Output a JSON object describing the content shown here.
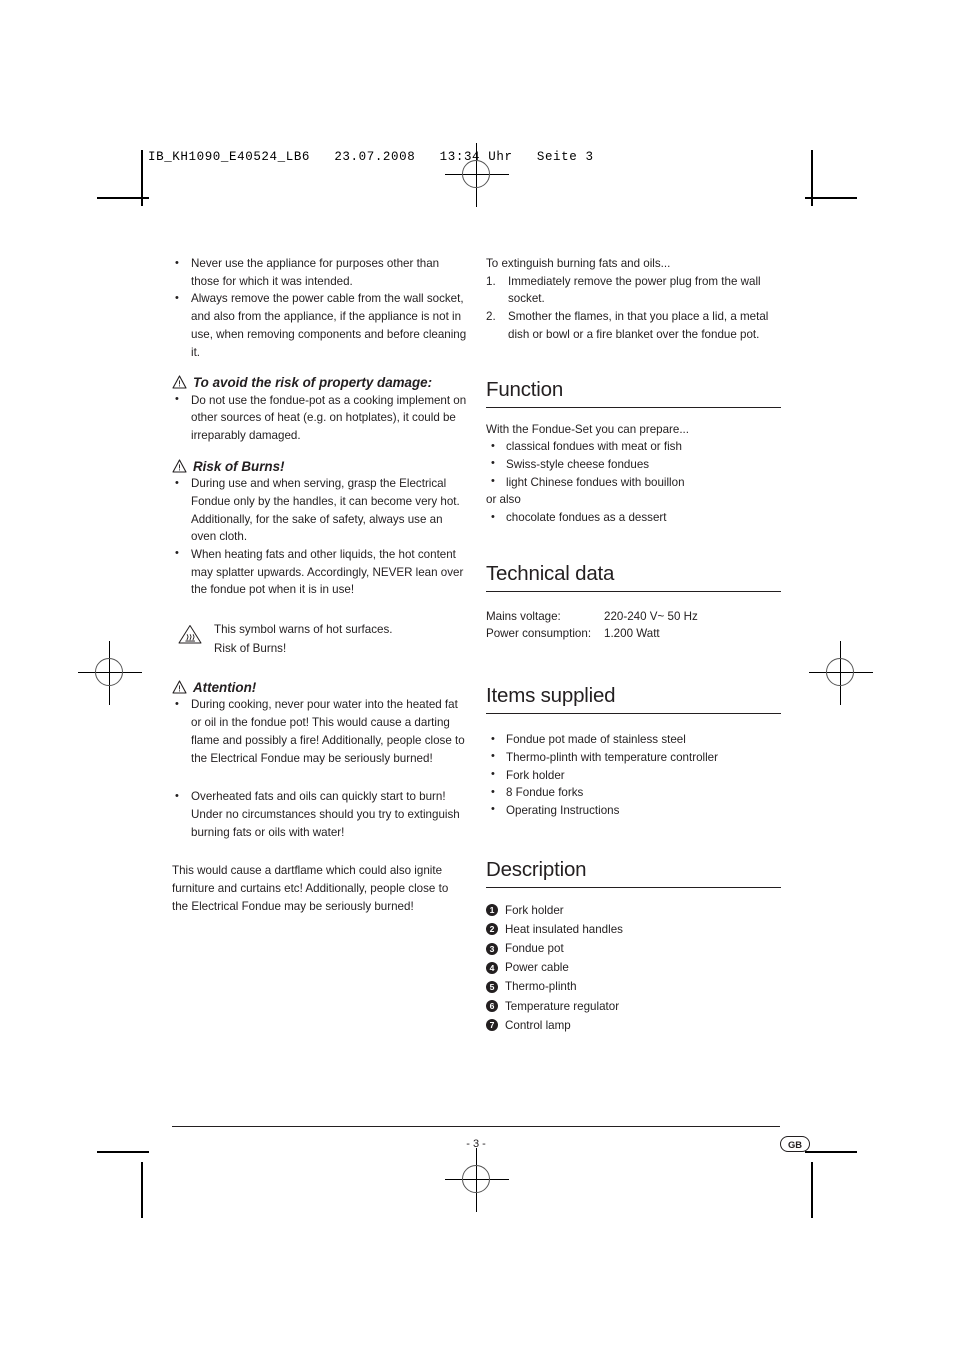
{
  "print_header": "IB_KH1090_E40524_LB6   23.07.2008   13:34 Uhr   Seite 3",
  "left_column": {
    "safety_bullets": [
      "Never use the appliance for purposes other than those for which it was intended.",
      "Always remove the power cable from the wall socket, and also from the appliance, if the appliance is not in use, when removing components and before cleaning it."
    ],
    "property_damage": {
      "heading": "To avoid the risk of property damage:",
      "bullets": [
        "Do not use the fondue-pot as a cooking implement on other sources of heat (e.g. on hotplates), it could be irreparably damaged."
      ]
    },
    "risk_of_burns": {
      "heading": "Risk of Burns!",
      "bullets": [
        "During use and when serving, grasp the Electrical Fondue only by the handles, it can become very hot. Additionally, for the sake of safety, always use an oven cloth.",
        "When heating fats and other liquids, the hot content may splatter upwards. Accordingly, NEVER lean over the fondue pot when it is in use!"
      ]
    },
    "symbol_note": {
      "line1": "This symbol warns of hot surfaces.",
      "line2": "Risk of Burns!"
    },
    "attention": {
      "heading": "Attention!",
      "bullets": [
        "During cooking, never pour water into the heated fat or oil in the fondue pot! This would cause a darting flame and possibly a fire! Additionally, people close to the Electrical Fondue may be seriously burned!",
        "Overheated fats and oils can quickly start to burn! Under no circumstances should you try to extinguish burning fats or oils with water!"
      ],
      "closing_paragraph": "This would cause a dartflame which could also ignite furniture and curtains etc! Additionally, people close to the Electrical Fondue may be seriously burned!"
    }
  },
  "right_column": {
    "extinguish": {
      "intro": "To extinguish burning fats and oils...",
      "steps": [
        "Immediately remove the power plug from the wall socket.",
        "Smother the flames, in that you place a lid, a metal dish or bowl or a fire blanket over the fondue pot."
      ]
    },
    "function": {
      "heading": "Function",
      "intro": "With the Fondue-Set you can prepare...",
      "items": [
        "classical fondues with meat or fish",
        "Swiss-style cheese fondues",
        "light Chinese fondues with bouillon"
      ],
      "or_also": "or also",
      "items2": [
        "chocolate fondues as a dessert"
      ]
    },
    "technical_data": {
      "heading": "Technical data",
      "rows": [
        {
          "key": "Mains voltage:",
          "value": "220-240 V~ 50 Hz"
        },
        {
          "key": "Power consumption:",
          "value": "1.200 Watt"
        }
      ]
    },
    "items_supplied": {
      "heading": "Items supplied",
      "items": [
        "Fondue pot made of stainless steel",
        "Thermo-plinth with temperature controller",
        "Fork holder",
        "8 Fondue forks",
        "Operating Instructions"
      ]
    },
    "description": {
      "heading": "Description",
      "items": [
        {
          "num": "1",
          "label": "Fork holder"
        },
        {
          "num": "2",
          "label": "Heat insulated handles"
        },
        {
          "num": "3",
          "label": "Fondue pot"
        },
        {
          "num": "4",
          "label": "Power cable"
        },
        {
          "num": "5",
          "label": "Thermo-plinth"
        },
        {
          "num": "6",
          "label": "Temperature regulator"
        },
        {
          "num": "7",
          "label": "Control lamp"
        }
      ]
    }
  },
  "footer": {
    "page_number": "- 3 -",
    "language_badge": "GB"
  },
  "colors": {
    "text": "#231f20",
    "rule": "#231f20"
  }
}
